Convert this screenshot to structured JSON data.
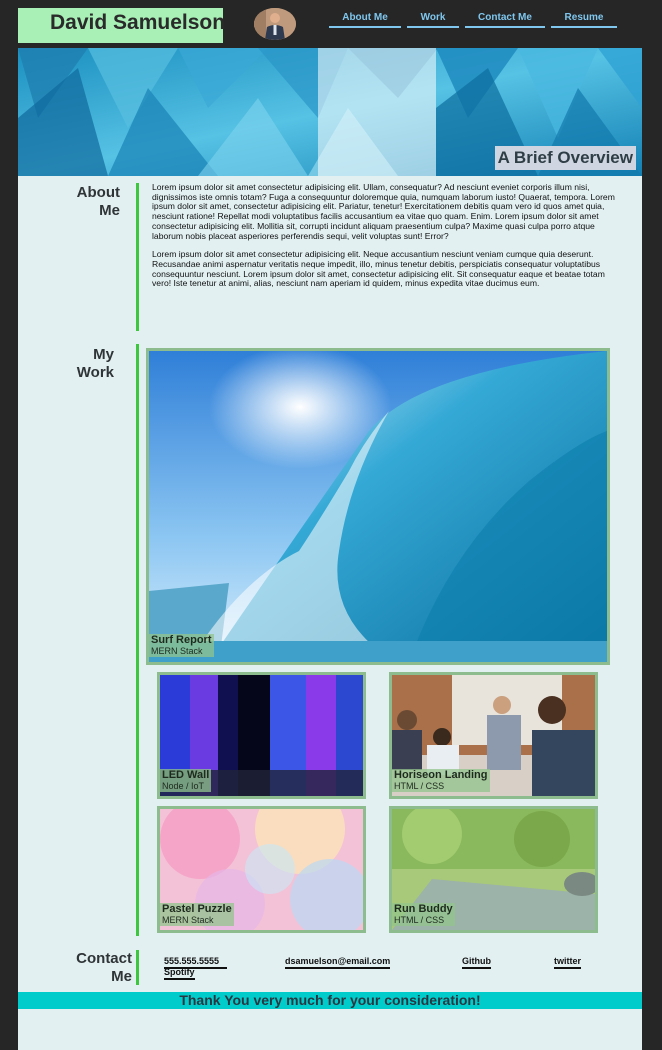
{
  "header": {
    "name": "David Samuelson",
    "nav": [
      "About Me",
      "Work",
      "Contact Me",
      "Resume"
    ]
  },
  "hero": {
    "overlay_text": "A Brief Overview"
  },
  "about": {
    "title_line1": "About",
    "title_line2": "Me",
    "paragraphs": [
      "Lorem ipsum dolor sit amet consectetur adipisicing elit. Ullam, consequatur? Ad nesciunt eveniet corporis illum nisi, dignissimos iste omnis totam? Fuga a consequuntur doloremque quia, numquam laborum iusto! Quaerat, tempora. Lorem ipsum dolor sit amet, consectetur adipisicing elit. Pariatur, tenetur! Exercitationem debitis quam vero id quos amet quia, nesciunt ratione! Repellat modi voluptatibus facilis accusantium ea vitae quo quam. Enim. Lorem ipsum dolor sit amet consectetur adipisicing elit. Mollitia sit, corrupti incidunt aliquam praesentium culpa? Maxime quasi culpa porro atque laborum nobis placeat asperiores perferendis sequi, velit voluptas sunt! Error?",
      "Lorem ipsum dolor sit amet consectetur adipisicing elit. Neque accusantium nesciunt veniam cumque quia deserunt. Recusandae animi aspernatur veritatis neque impedit, illo, minus tenetur debitis, perspiciatis consequatur voluptatibus consequuntur nesciunt. Lorem ipsum dolor sit amet, consectetur adipisicing elit. Sit consequatur eaque et beatae totam vero! Iste tenetur at animi, alias, nesciunt nam aperiam id quidem, minus expedita vitae ducimus eum."
    ]
  },
  "work": {
    "title_line1": "My",
    "title_line2": "Work",
    "projects": [
      {
        "title": "Surf Report",
        "stack": "MERN Stack"
      },
      {
        "title": "LED Wall",
        "stack": "Node / IoT"
      },
      {
        "title": "Horiseon Landing",
        "stack": "HTML / CSS"
      },
      {
        "title": "Pastel Puzzle",
        "stack": "MERN Stack"
      },
      {
        "title": "Run Buddy",
        "stack": "HTML / CSS"
      }
    ]
  },
  "contact": {
    "title_line1": "Contact",
    "title_line2": "Me",
    "phone": "555.555.5555",
    "spotify": "Spotify",
    "email": "dsamuelson@email.com",
    "github": "Github",
    "twitter": "twitter"
  },
  "footer": {
    "text": "Thank You very much for your consideration!"
  },
  "colors": {
    "header_bg": "#262626",
    "name_bg": "#a8f0b6",
    "nav_link": "#7fc7ee",
    "page_bg": "#e2f0f2",
    "accent_bar": "#3ec63e",
    "card_border": "#8dbc8e",
    "footer_bg": "#00cccc"
  }
}
